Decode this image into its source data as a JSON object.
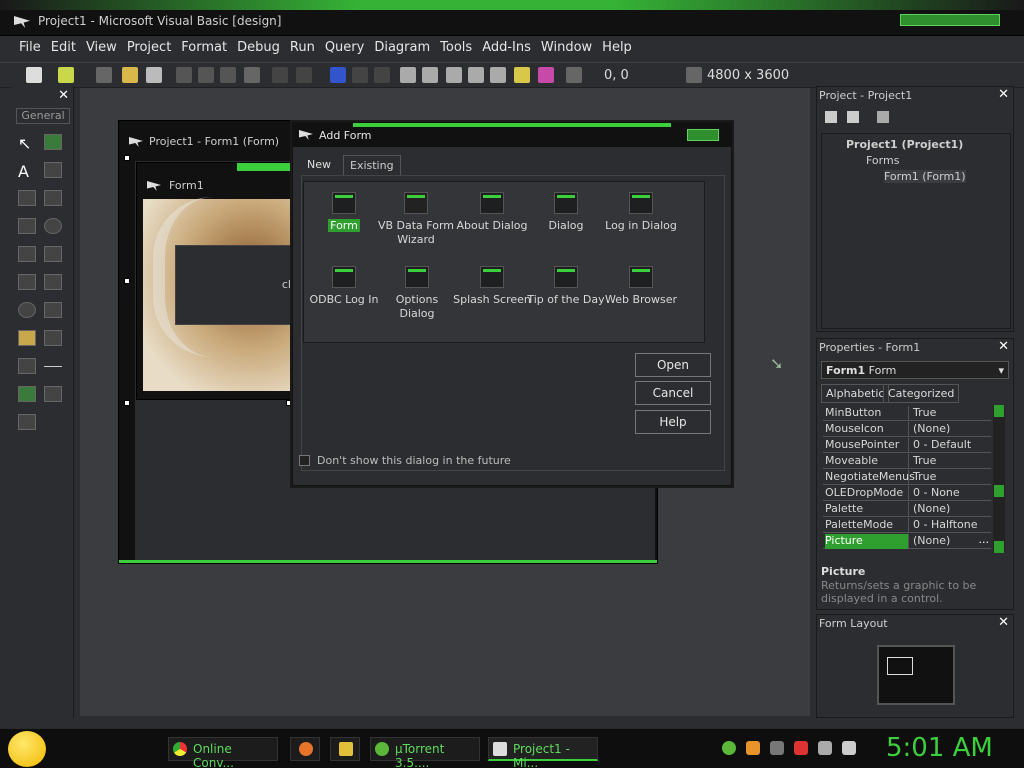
{
  "window": {
    "title": "Project1 - Microsoft Visual Basic [design]"
  },
  "menu": [
    "File",
    "Edit",
    "View",
    "Project",
    "Format",
    "Debug",
    "Run",
    "Query",
    "Diagram",
    "Tools",
    "Add-Ins",
    "Window",
    "Help"
  ],
  "toolbar": {
    "coords": "0, 0",
    "size": "4800 x 3600"
  },
  "toolbox": {
    "tab": "General"
  },
  "form_designer": {
    "title": "Project1 - Form1 (Form)",
    "inner_title": "Form1",
    "label_text": "cli"
  },
  "dialog": {
    "title": "Add Form",
    "tabs": [
      "New",
      "Existing"
    ],
    "items": [
      {
        "label": "Form",
        "selected": true
      },
      {
        "label": "VB Data Form Wizard"
      },
      {
        "label": "About Dialog"
      },
      {
        "label": "Dialog"
      },
      {
        "label": "Log in Dialog"
      },
      {
        "label": "ODBC Log In"
      },
      {
        "label": "Options Dialog"
      },
      {
        "label": "Splash Screen"
      },
      {
        "label": "Tip of the Day"
      },
      {
        "label": "Web Browser"
      }
    ],
    "buttons": {
      "open": "Open",
      "cancel": "Cancel",
      "help": "Help"
    },
    "checkbox_label": "Don't show this dialog in the future"
  },
  "project_panel": {
    "title": "Project - Project1",
    "tree": [
      "Project1 (Project1)",
      "Forms",
      "Form1 (Form1)"
    ]
  },
  "properties_panel": {
    "title": "Properties - Form1",
    "object_bold": "Form1",
    "object_type": "Form",
    "tabs": [
      "Alphabetic",
      "Categorized"
    ],
    "rows": [
      {
        "name": "MinButton",
        "value": "True"
      },
      {
        "name": "MouseIcon",
        "value": "(None)"
      },
      {
        "name": "MousePointer",
        "value": "0 - Default"
      },
      {
        "name": "Moveable",
        "value": "True"
      },
      {
        "name": "NegotiateMenus",
        "value": "True"
      },
      {
        "name": "OLEDropMode",
        "value": "0 - None"
      },
      {
        "name": "Palette",
        "value": "(None)"
      },
      {
        "name": "PaletteMode",
        "value": "0 - Halftone"
      },
      {
        "name": "Picture",
        "value": "(None)",
        "selected": true
      }
    ],
    "desc_title": "Picture",
    "desc": "Returns/sets a graphic to be displayed in a control."
  },
  "layout_panel": {
    "title": "Form Layout"
  },
  "taskbar": {
    "tasks": [
      "Online Conv...",
      "µTorrent 3.5....",
      "Project1 - Mi..."
    ],
    "clock": "5:01 AM"
  },
  "colors": {
    "accent": "#3ccf3c",
    "background": "#2b2d30"
  }
}
